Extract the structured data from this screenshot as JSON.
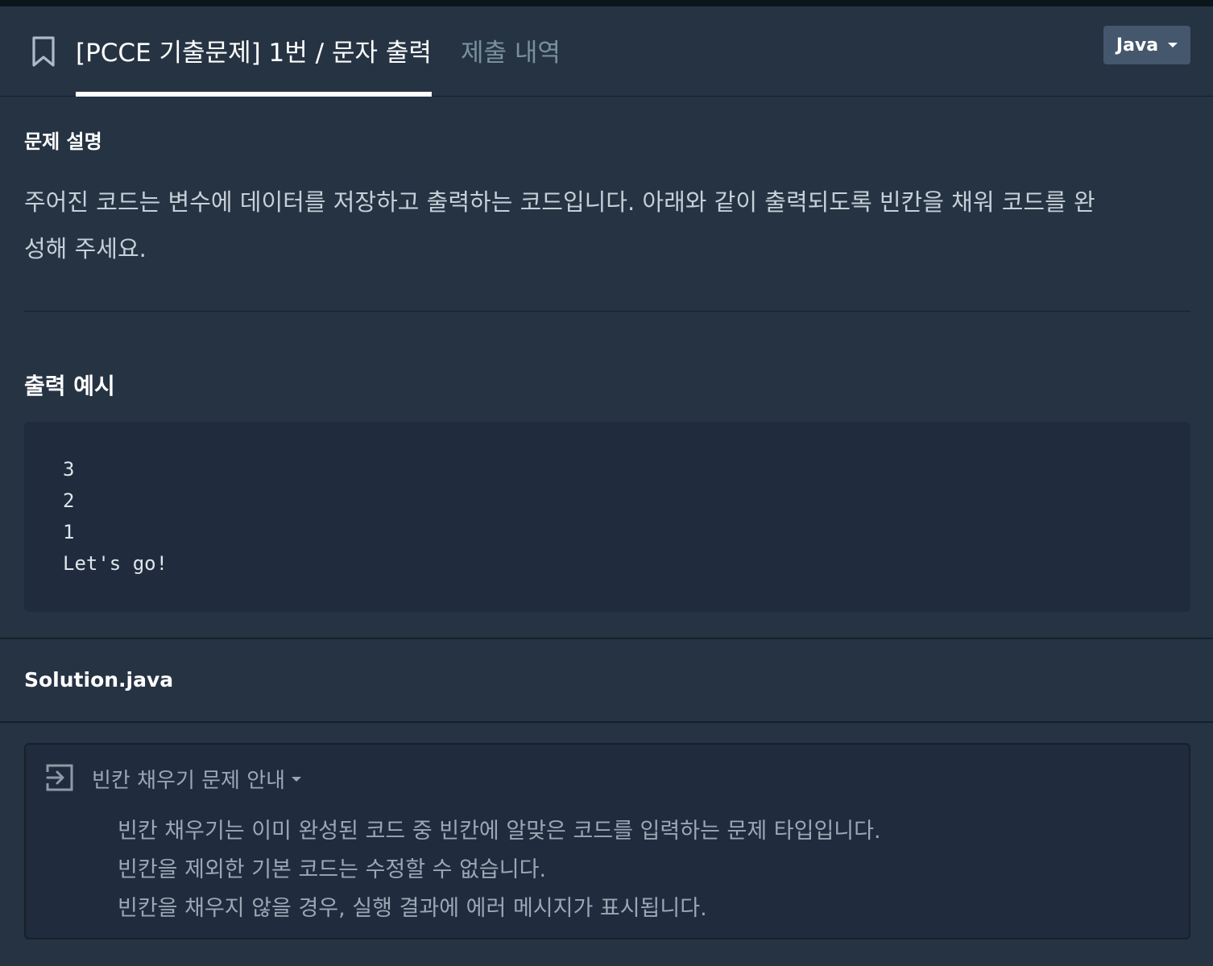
{
  "header": {
    "problem_tab": "[PCCE 기출문제] 1번 / 문자 출력",
    "history_tab": "제출 내역",
    "language": "Java"
  },
  "description": {
    "heading": "문제 설명",
    "line1": "주어진 코드는 변수에 데이터를 저장하고 출력하는 코드입니다. 아래와 같이 출력되도록 빈칸을 채워 코드를 완",
    "line2": "성해 주세요."
  },
  "output_example": {
    "heading": "출력 예시",
    "lines": [
      "3",
      "2",
      "1",
      "Let's go!"
    ]
  },
  "file": {
    "name": "Solution.java"
  },
  "guide": {
    "title": "빈칸 채우기 문제 안내",
    "lines": [
      "빈칸 채우기는 이미 완성된 코드 중 빈칸에 알맞은 코드를 입력하는 문제 타입입니다.",
      "빈칸을 제외한 기본 코드는 수정할 수 없습니다.",
      "빈칸을 채우지 않을 경우, 실행 결과에 에러 메시지가 표시됩니다."
    ]
  }
}
